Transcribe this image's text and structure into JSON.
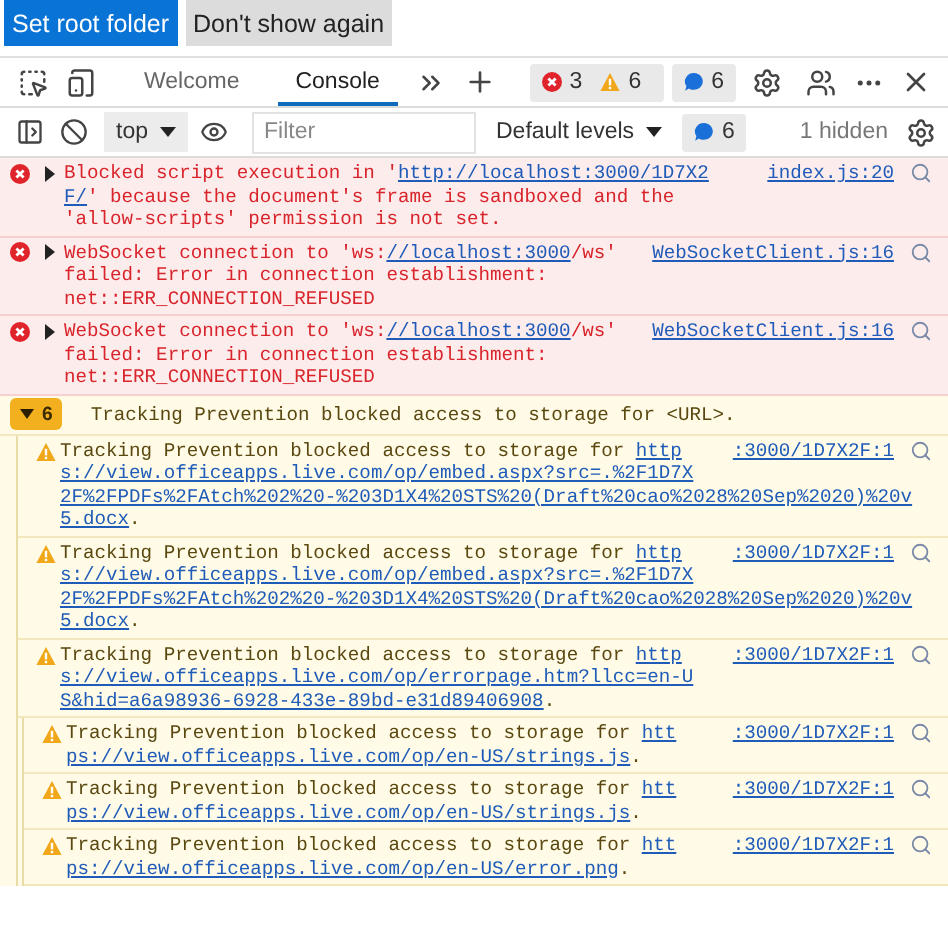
{
  "banner": {
    "buttons": [
      {
        "label": "Set root folder",
        "kind": "primary"
      },
      {
        "label": "Don't show again",
        "kind": "secondary"
      }
    ]
  },
  "tabs": [
    {
      "label": "Welcome",
      "selected": false
    },
    {
      "label": "Console",
      "selected": true
    }
  ],
  "issue_counts": [
    {
      "kind": "error",
      "count": "3"
    },
    {
      "kind": "warning",
      "count": "6"
    }
  ],
  "info_count": "6",
  "toolbar": {
    "context": "top",
    "filter_placeholder": "Filter",
    "levels": "Default levels",
    "info_count": "6",
    "hidden": "1 hidden"
  },
  "messages": [
    {
      "kind": "error",
      "expanded": false,
      "source": "index.js:20",
      "lines": [
        [
          {
            "text": "Blocked script execution in '"
          },
          {
            "text": "http://localhost:3000/1D7X2",
            "link": true
          }
        ],
        [
          {
            "text": "F/",
            "link": true
          },
          {
            "text": "' because the document's frame is sandboxed and the"
          }
        ],
        [
          {
            "text": "'allow-scripts' permission is not set."
          }
        ]
      ]
    },
    {
      "kind": "error",
      "expanded": false,
      "source": "WebSocketClient.js:16",
      "lines": [
        [
          {
            "text": "WebSocket connection to 'ws:"
          },
          {
            "text": "//localhost:3000",
            "link": true
          },
          {
            "text": "/ws'"
          }
        ],
        [
          {
            "text": "failed: Error in connection establishment:"
          }
        ],
        [
          {
            "text": "net::ERR_CONNECTION_REFUSED"
          }
        ]
      ]
    },
    {
      "kind": "error",
      "expanded": false,
      "source": "WebSocketClient.js:16",
      "lines": [
        [
          {
            "text": "WebSocket connection to 'ws:"
          },
          {
            "text": "//localhost:3000",
            "link": true
          },
          {
            "text": "/ws'"
          }
        ],
        [
          {
            "text": "failed: Error in connection establishment:"
          }
        ],
        [
          {
            "text": "net::ERR_CONNECTION_REFUSED"
          }
        ]
      ]
    },
    {
      "kind": "group",
      "expanded": true,
      "count": "6",
      "text": "Tracking Prevention blocked access to storage for <URL>.",
      "children": [
        {
          "kind": "warning",
          "source": ":3000/1D7X2F:1",
          "lines": [
            [
              {
                "text": "Tracking Prevention blocked access to storage for "
              },
              {
                "text": "http",
                "link": true
              }
            ],
            [
              {
                "text": "s://view.officeapps.live.com/op/embed.aspx?src=.%2F1D7X",
                "link": true
              }
            ],
            [
              {
                "text": "2F%2FPDFs%2FAtch%202%20-%203D1X4%20STS%20(Draft%20cao%2028%20Sep%2020)%20v",
                "link": true
              }
            ],
            [
              {
                "text": "5.docx",
                "link": true
              },
              {
                "text": "."
              }
            ]
          ]
        },
        {
          "kind": "warning",
          "source": ":3000/1D7X2F:1",
          "lines": [
            [
              {
                "text": "Tracking Prevention blocked access to storage for "
              },
              {
                "text": "http",
                "link": true
              }
            ],
            [
              {
                "text": "s://view.officeapps.live.com/op/embed.aspx?src=.%2F1D7X",
                "link": true
              }
            ],
            [
              {
                "text": "2F%2FPDFs%2FAtch%202%20-%203D1X4%20STS%20(Draft%20cao%2028%20Sep%2020)%20v",
                "link": true
              }
            ],
            [
              {
                "text": "5.docx",
                "link": true
              },
              {
                "text": "."
              }
            ]
          ]
        },
        {
          "kind": "warning",
          "source": ":3000/1D7X2F:1",
          "lines": [
            [
              {
                "text": "Tracking Prevention blocked access to storage for "
              },
              {
                "text": "http",
                "link": true
              }
            ],
            [
              {
                "text": "s://view.officeapps.live.com/op/errorpage.htm?llcc=en-U",
                "link": true
              }
            ],
            [
              {
                "text": "S&hid=a6a98936-6928-433e-89bd-e31d89406908",
                "link": true
              },
              {
                "text": "."
              }
            ]
          ],
          "children": [
            {
              "kind": "warning",
              "source": ":3000/1D7X2F:1",
              "lines": [
                [
                  {
                    "text": "Tracking Prevention blocked access to storage for "
                  },
                  {
                    "text": "htt",
                    "link": true
                  }
                ],
                [
                  {
                    "text": "ps://view.officeapps.live.com/op/en-US/strings.js",
                    "link": true
                  },
                  {
                    "text": "."
                  }
                ]
              ]
            },
            {
              "kind": "warning",
              "source": ":3000/1D7X2F:1",
              "lines": [
                [
                  {
                    "text": "Tracking Prevention blocked access to storage for "
                  },
                  {
                    "text": "htt",
                    "link": true
                  }
                ],
                [
                  {
                    "text": "ps://view.officeapps.live.com/op/en-US/strings.js",
                    "link": true
                  },
                  {
                    "text": "."
                  }
                ]
              ]
            },
            {
              "kind": "warning",
              "source": ":3000/1D7X2F:1",
              "lines": [
                [
                  {
                    "text": "Tracking Prevention blocked access to storage for "
                  },
                  {
                    "text": "htt",
                    "link": true
                  }
                ],
                [
                  {
                    "text": "ps://view.officeapps.live.com/op/en-US/error.png",
                    "link": true
                  },
                  {
                    "text": "."
                  }
                ]
              ]
            }
          ]
        }
      ]
    }
  ]
}
